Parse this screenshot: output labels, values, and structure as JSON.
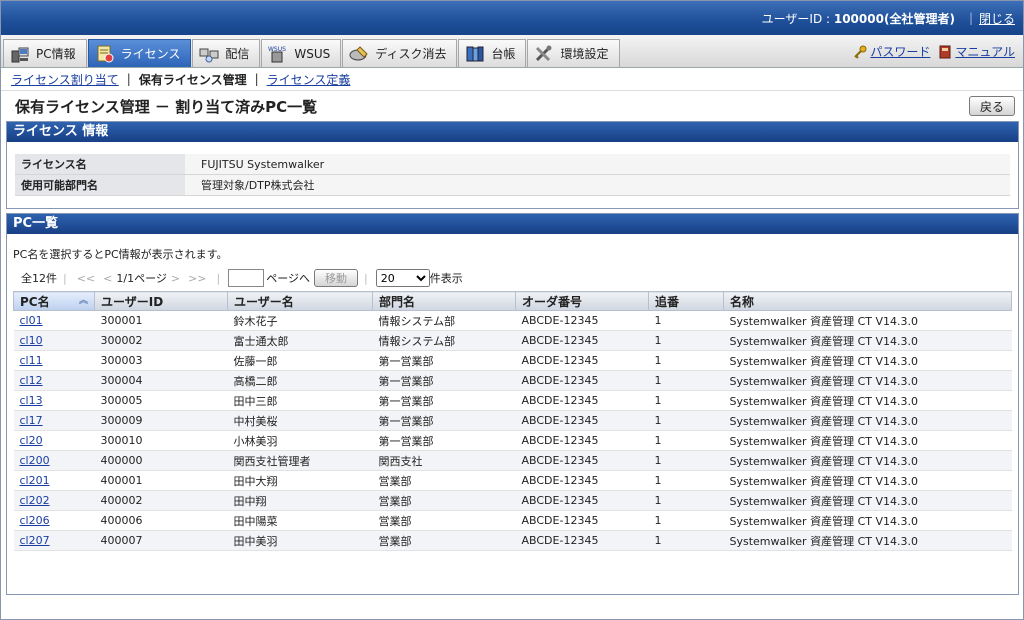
{
  "topbar": {
    "user_label": "ユーザーID : ",
    "user_value": "100000(全社管理者)",
    "close": "閉じる"
  },
  "tabs": [
    {
      "label": "PC情報",
      "icon": "pc-icon"
    },
    {
      "label": "ライセンス",
      "icon": "license-icon",
      "active": true
    },
    {
      "label": "配信",
      "icon": "distribution-icon"
    },
    {
      "label": "WSUS",
      "icon": "wsus-icon"
    },
    {
      "label": "ディスク消去",
      "icon": "disk-erase-icon"
    },
    {
      "label": "台帳",
      "icon": "ledger-icon"
    },
    {
      "label": "環境設定",
      "icon": "settings-icon"
    }
  ],
  "rightlinks": {
    "password": "パスワード",
    "manual": "マニュアル"
  },
  "subnav": {
    "assign": "ライセンス割り当て",
    "current": "保有ライセンス管理",
    "define": "ライセンス定義"
  },
  "page": {
    "title": "保有ライセンス管理 － 割り当て済みPC一覧",
    "back": "戻る"
  },
  "license_info": {
    "heading": "ライセンス 情報",
    "rows": [
      {
        "key": "ライセンス名",
        "value": "FUJITSU Systemwalker"
      },
      {
        "key": "使用可能部門名",
        "value": "管理対象/DTP株式会社"
      }
    ]
  },
  "pc_list": {
    "heading": "PC一覧",
    "note": "PC名を選択するとPC情報が表示されます。",
    "total": "全12件",
    "first": "<<",
    "prev": "<",
    "page_info": "1/1ページ",
    "next": ">",
    "last": ">>",
    "page_to": "ページへ",
    "move": "移動",
    "per_page": "20",
    "per_page_suffix": "件表示",
    "columns": [
      "PC名",
      "ユーザーID",
      "ユーザー名",
      "部門名",
      "オーダ番号",
      "追番",
      "名称"
    ],
    "rows": [
      [
        "cl01",
        "300001",
        "鈴木花子",
        "情報システム部",
        "ABCDE-12345",
        "1",
        "Systemwalker 資産管理 CT V14.3.0"
      ],
      [
        "cl10",
        "300002",
        "富士通太郎",
        "情報システム部",
        "ABCDE-12345",
        "1",
        "Systemwalker 資産管理 CT V14.3.0"
      ],
      [
        "cl11",
        "300003",
        "佐藤一郎",
        "第一営業部",
        "ABCDE-12345",
        "1",
        "Systemwalker 資産管理 CT V14.3.0"
      ],
      [
        "cl12",
        "300004",
        "高橋二郎",
        "第一営業部",
        "ABCDE-12345",
        "1",
        "Systemwalker 資産管理 CT V14.3.0"
      ],
      [
        "cl13",
        "300005",
        "田中三郎",
        "第一営業部",
        "ABCDE-12345",
        "1",
        "Systemwalker 資産管理 CT V14.3.0"
      ],
      [
        "cl17",
        "300009",
        "中村美桜",
        "第一営業部",
        "ABCDE-12345",
        "1",
        "Systemwalker 資産管理 CT V14.3.0"
      ],
      [
        "cl20",
        "300010",
        "小林美羽",
        "第一営業部",
        "ABCDE-12345",
        "1",
        "Systemwalker 資産管理 CT V14.3.0"
      ],
      [
        "cl200",
        "400000",
        "関西支社管理者",
        "関西支社",
        "ABCDE-12345",
        "1",
        "Systemwalker 資産管理 CT V14.3.0"
      ],
      [
        "cl201",
        "400001",
        "田中大翔",
        "営業部",
        "ABCDE-12345",
        "1",
        "Systemwalker 資産管理 CT V14.3.0"
      ],
      [
        "cl202",
        "400002",
        "田中翔",
        "営業部",
        "ABCDE-12345",
        "1",
        "Systemwalker 資産管理 CT V14.3.0"
      ],
      [
        "cl206",
        "400006",
        "田中陽菜",
        "営業部",
        "ABCDE-12345",
        "1",
        "Systemwalker 資産管理 CT V14.3.0"
      ],
      [
        "cl207",
        "400007",
        "田中美羽",
        "営業部",
        "ABCDE-12345",
        "1",
        "Systemwalker 資産管理 CT V14.3.0"
      ]
    ]
  }
}
